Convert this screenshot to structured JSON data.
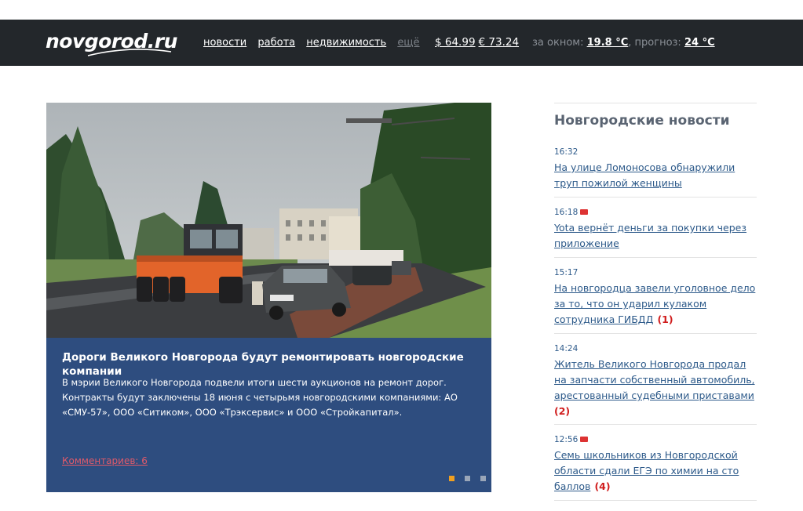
{
  "header": {
    "logo": "novgorod.ru",
    "nav": [
      {
        "label": "новости"
      },
      {
        "label": "работа"
      },
      {
        "label": "недвижимость"
      },
      {
        "label": "ещё"
      }
    ],
    "currency": {
      "usd": "$ 64.99",
      "eur": "€ 73.24"
    },
    "weather": {
      "outside_label": "за окном:",
      "outside_value": "19.8 °С",
      "forecast_label": ", прогноз:",
      "forecast_value": "24 °С"
    }
  },
  "hero": {
    "title": "Дороги Великого Новгорода будут ремонтировать новгородские компании",
    "text": "В мэрии Великого Новгорода подвели итоги шести аукционов на ремонт дорог. Контракты будут заключены 18 июня с четырьмя новгородскими компаниями: АО «СМУ-57», ООО «Ситиком», ООО «Трэксервис» и ООО «Стройкапитал».",
    "comments": "Комментариев: 6",
    "slides_total": 3,
    "slide_active": 1
  },
  "sidebar": {
    "title": "Новгородские новости",
    "items": [
      {
        "time": "16:32",
        "photo": false,
        "title": "На улице Ломоносова обнаружили труп пожилой женщины",
        "count": ""
      },
      {
        "time": "16:18",
        "photo": true,
        "title": "Yota вернёт деньги за покупки через приложение",
        "count": ""
      },
      {
        "time": "15:17",
        "photo": false,
        "title": "На новгородца завели уголовное дело за то, что он ударил кулаком сотрудника ГИБДД",
        "count": "(1)"
      },
      {
        "time": "14:24",
        "photo": false,
        "title": "Житель Великого Новгорода продал на запчасти собственный автомобиль, арестованный судебными приставами",
        "count": "(2)"
      },
      {
        "time": "12:56",
        "photo": true,
        "title": "Семь школьников из Новгородской области сдали ЕГЭ по химии на сто баллов",
        "count": "(4)"
      }
    ]
  },
  "colors": {
    "header_bg": "#23272b",
    "caption_bg": "#2e4d7f",
    "link": "#2d5a8a",
    "accent_red": "#d01c1c",
    "dot_active": "#f0a020"
  }
}
